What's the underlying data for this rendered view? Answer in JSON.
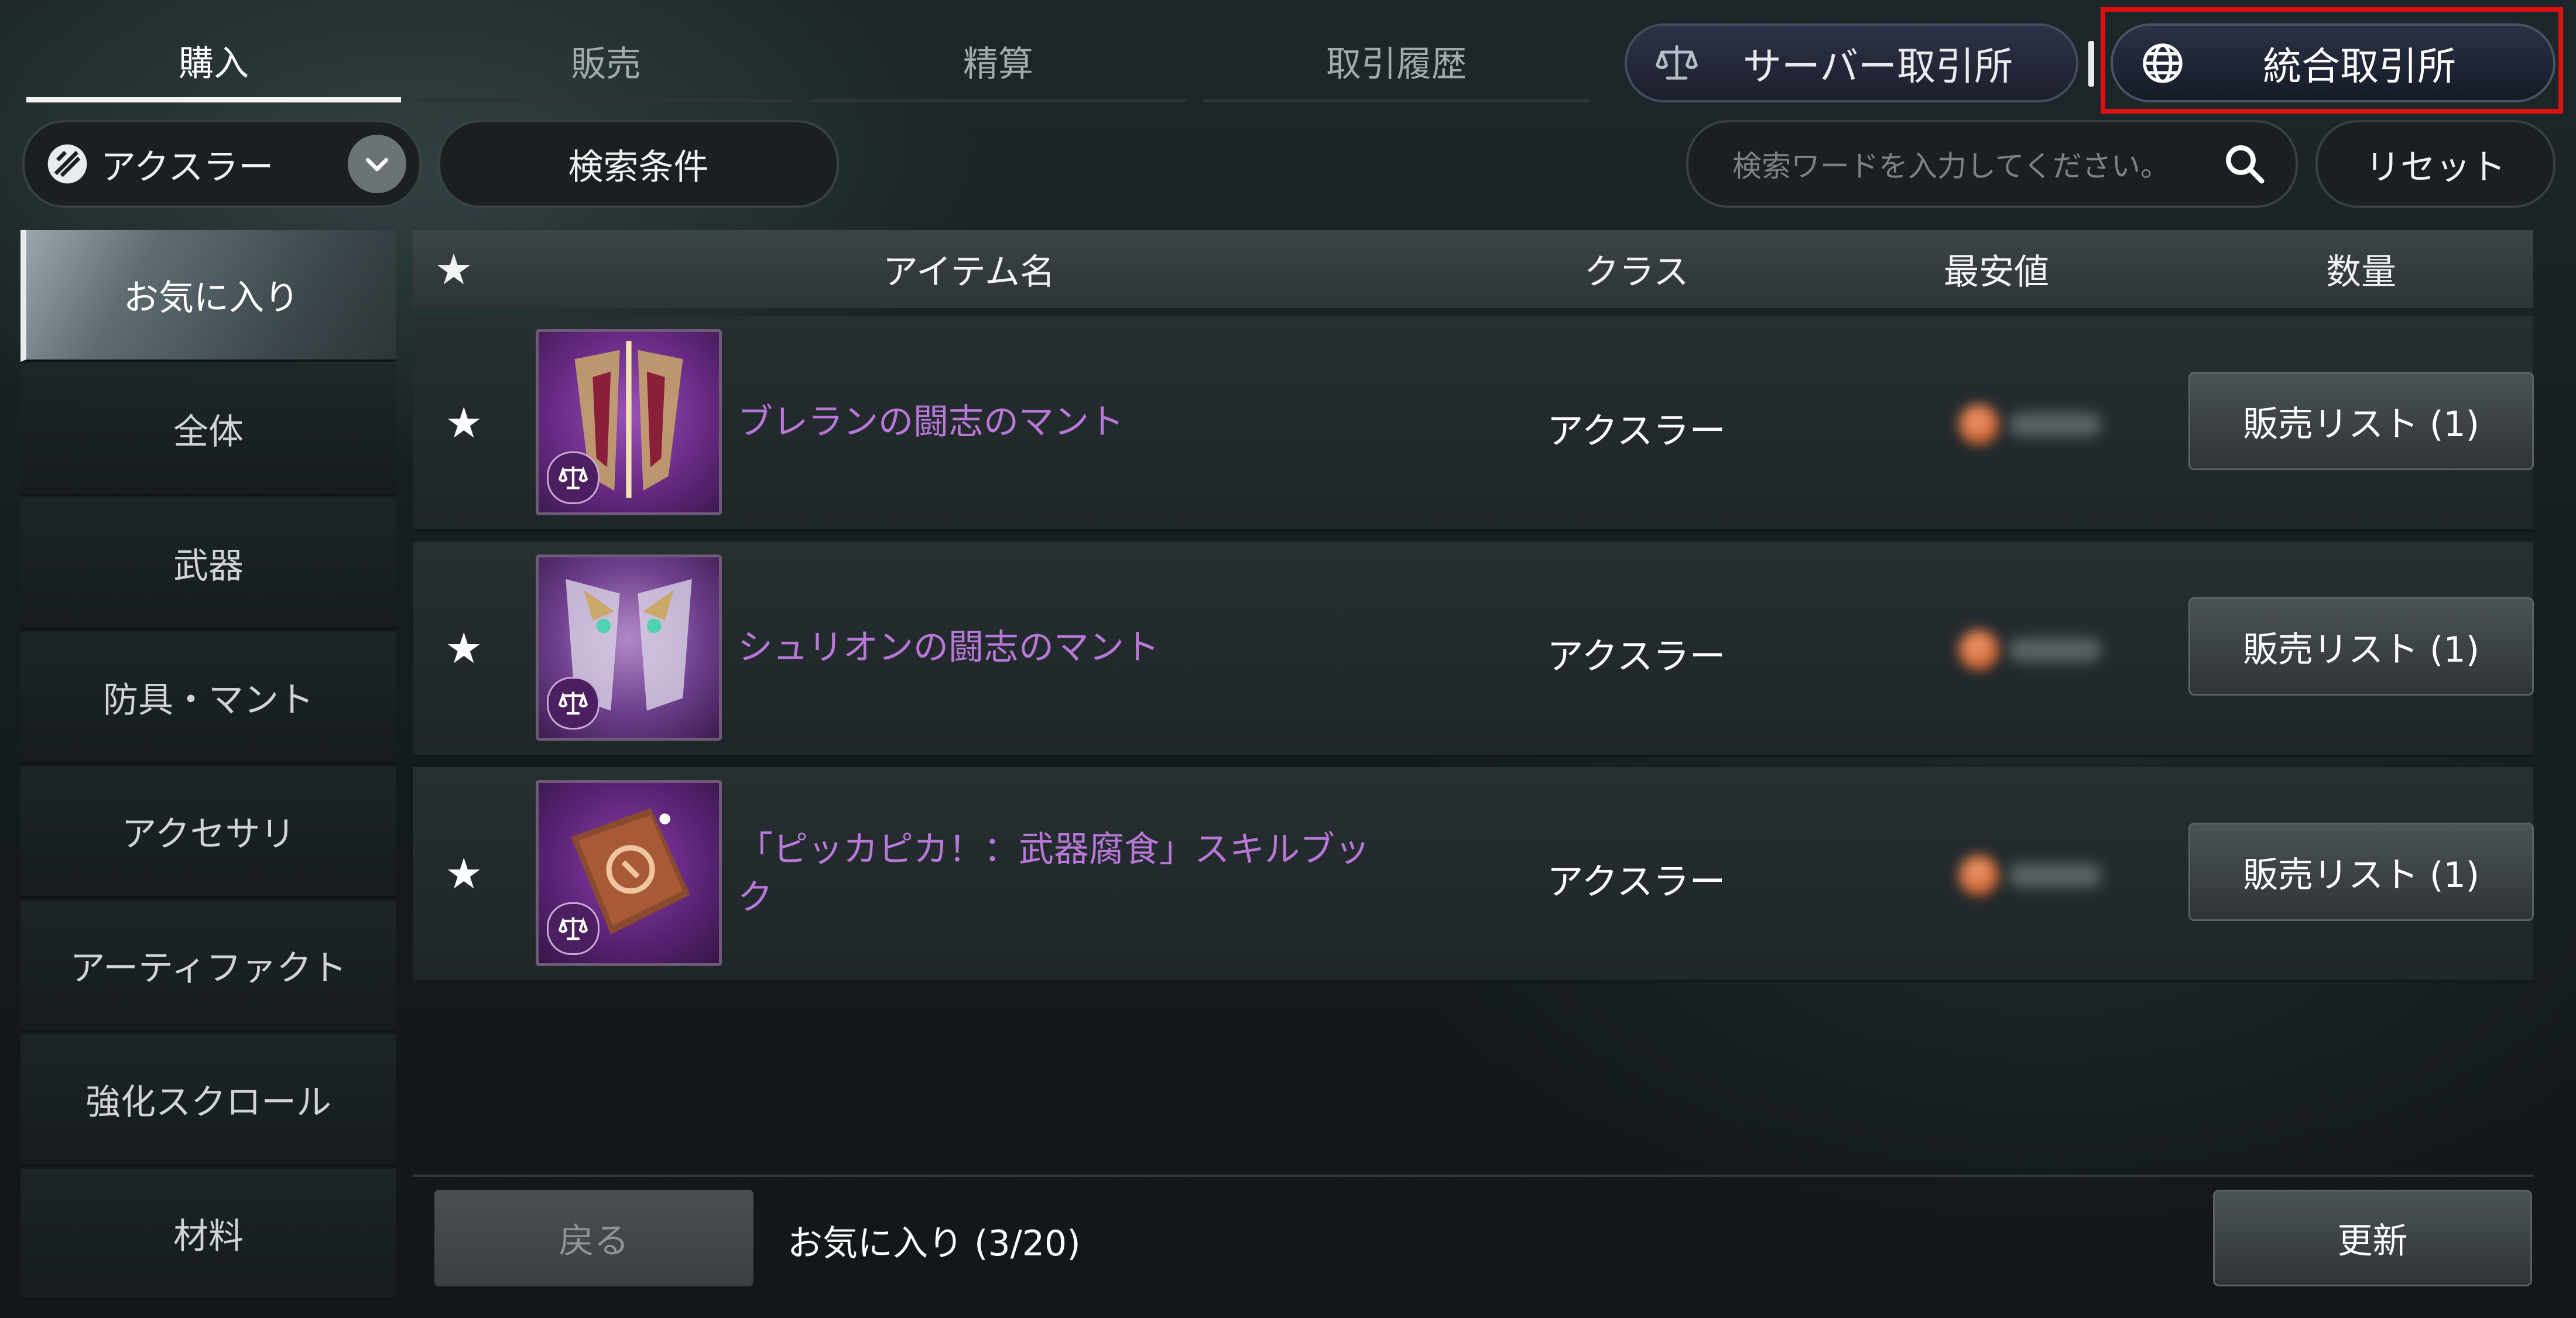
{
  "tabs": [
    {
      "label": "購入",
      "active": true
    },
    {
      "label": "販売",
      "active": false
    },
    {
      "label": "精算",
      "active": false
    },
    {
      "label": "取引履歴",
      "active": false
    }
  ],
  "exchange": {
    "server_label": "サーバー取引所",
    "integrated_label": "統合取引所",
    "integrated_highlighted": true,
    "highlight_color": "#e01010"
  },
  "filters": {
    "class_select": "アクスラー",
    "search_conditions_label": "検索条件",
    "search_placeholder": "検索ワードを入力してください。",
    "reset_label": "リセット"
  },
  "sidebar": {
    "items": [
      {
        "label": "お気に入り",
        "active": true
      },
      {
        "label": "全体",
        "active": false
      },
      {
        "label": "武器",
        "active": false
      },
      {
        "label": "防具・マント",
        "active": false
      },
      {
        "label": "アクセサリ",
        "active": false
      },
      {
        "label": "アーティファクト",
        "active": false
      },
      {
        "label": "強化スクロール",
        "active": false
      },
      {
        "label": "材料",
        "active": false
      }
    ]
  },
  "table": {
    "headers": {
      "star": "★",
      "name": "アイテム名",
      "class": "クラス",
      "lowest_price": "最安値",
      "quantity": "数量"
    },
    "rows": [
      {
        "star": "★",
        "name": "ブレランの闘志のマント",
        "class": "アクスラー",
        "action": "販売リスト (1)",
        "icon": "cloak-icon",
        "price_blurred": true
      },
      {
        "star": "★",
        "name": "シュリオンの闘志のマント",
        "class": "アクスラー",
        "action": "販売リスト (1)",
        "icon": "cloak-icon",
        "price_blurred": true
      },
      {
        "star": "★",
        "name": "「ピッカピカ！：武器腐食」スキルブック",
        "class": "アクスラー",
        "action": "販売リスト (1)",
        "icon": "skillbook-icon",
        "price_blurred": true
      }
    ]
  },
  "footer": {
    "back_label": "戻る",
    "favorites_count": "お気に入り (3/20)",
    "update_label": "更新"
  },
  "colors": {
    "item_name": "#b878d8",
    "thumb_purple": "#6a2b86",
    "price_coin": "#c75b2e"
  }
}
